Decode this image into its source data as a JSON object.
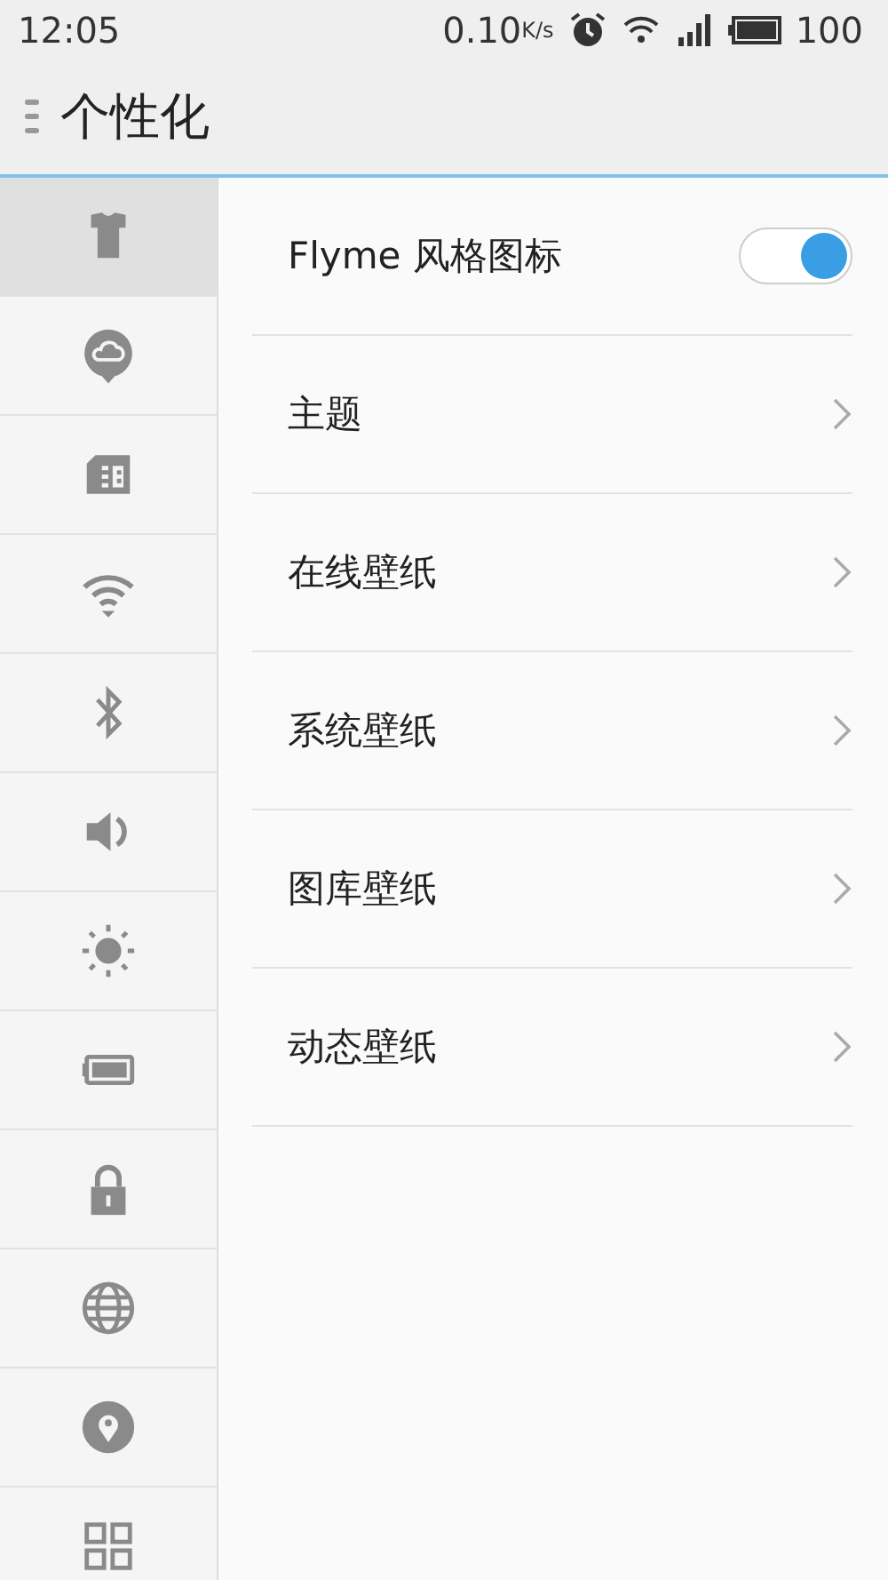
{
  "status_bar": {
    "time": "12:05",
    "speed": "0.10",
    "speed_unit": "K/s",
    "battery": "100"
  },
  "header": {
    "title": "个性化"
  },
  "sidebar": {
    "items": [
      {
        "kind": "shirt",
        "selected": true
      },
      {
        "kind": "cloud",
        "selected": false
      },
      {
        "kind": "sim",
        "selected": false
      },
      {
        "kind": "wifi",
        "selected": false
      },
      {
        "kind": "bluetooth",
        "selected": false
      },
      {
        "kind": "volume",
        "selected": false
      },
      {
        "kind": "brightness",
        "selected": false
      },
      {
        "kind": "battery",
        "selected": false
      },
      {
        "kind": "lock",
        "selected": false
      },
      {
        "kind": "globe",
        "selected": false
      },
      {
        "kind": "location",
        "selected": false
      },
      {
        "kind": "apps",
        "selected": false
      }
    ]
  },
  "settings": [
    {
      "kind": "toggle",
      "label": "Flyme 风格图标",
      "on": true
    },
    {
      "kind": "link",
      "label": "主题"
    },
    {
      "kind": "link",
      "label": "在线壁纸"
    },
    {
      "kind": "link",
      "label": "系统壁纸"
    },
    {
      "kind": "link",
      "label": "图库壁纸"
    },
    {
      "kind": "link",
      "label": "动态壁纸"
    }
  ]
}
